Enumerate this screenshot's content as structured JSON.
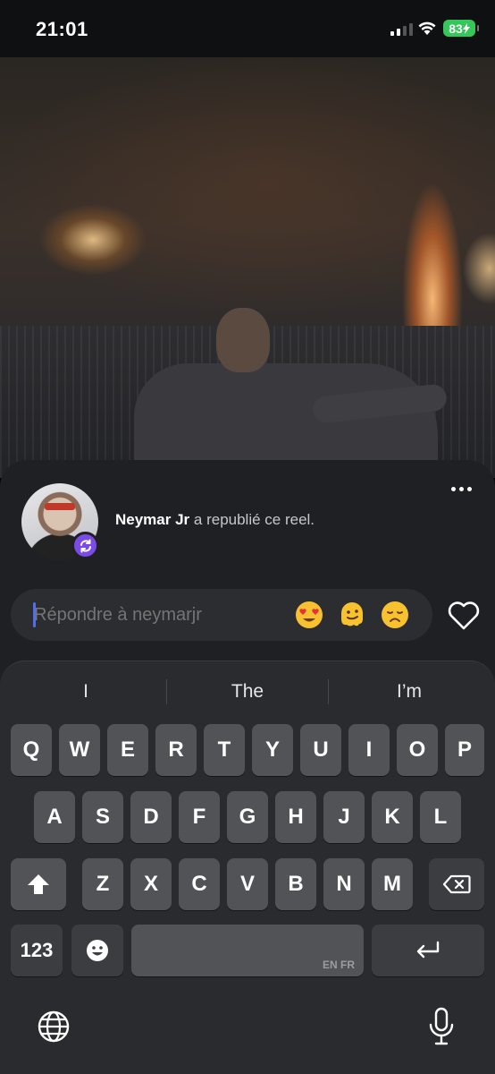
{
  "status_bar": {
    "time": "21:01",
    "battery": "83"
  },
  "post": {
    "author": "Neymar Jr",
    "action_text": " a republié ce reel."
  },
  "reply": {
    "placeholder": "Répondre à neymarjr",
    "emojis": [
      "heart-eyes-emoji",
      "melting-face-emoji",
      "disappointed-face-emoji"
    ]
  },
  "keyboard": {
    "suggestions": [
      "I",
      "The",
      "I’m"
    ],
    "row1": [
      "Q",
      "W",
      "E",
      "R",
      "T",
      "Y",
      "U",
      "I",
      "O",
      "P"
    ],
    "row2": [
      "A",
      "S",
      "D",
      "F",
      "G",
      "H",
      "J",
      "K",
      "L"
    ],
    "row3": [
      "Z",
      "X",
      "C",
      "V",
      "B",
      "N",
      "M"
    ],
    "numbers_label": "123",
    "space_sublabel": "EN FR"
  },
  "colors": {
    "accent_badge": "#7b4be6",
    "battery": "#34c759",
    "caret": "#4f6df5"
  }
}
